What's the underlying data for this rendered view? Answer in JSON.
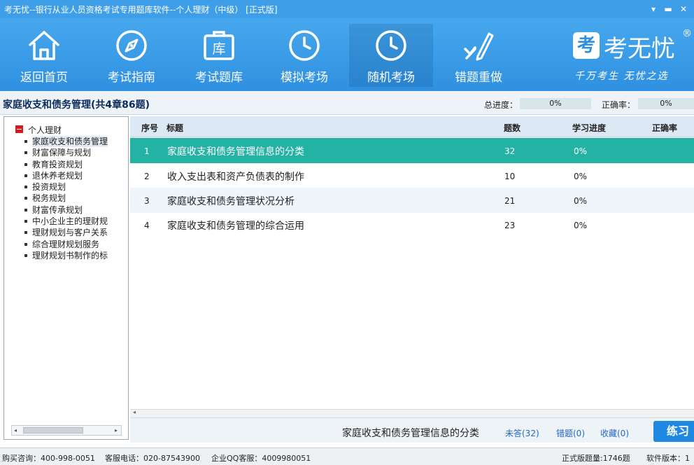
{
  "window": {
    "title": "考无忧--银行从业人员资格考试专用题库软件--个人理财（中级）  [正式版]",
    "menu_glyph": "▾",
    "min_glyph": "▬",
    "close_glyph": "✕"
  },
  "toolbar": {
    "items": [
      {
        "label": "返回首页",
        "icon": "home-icon"
      },
      {
        "label": "考试指南",
        "icon": "compass-icon"
      },
      {
        "label": "考试题库",
        "icon": "question-bank-icon",
        "icon_text": "库"
      },
      {
        "label": "模拟考场",
        "icon": "clock-icon"
      },
      {
        "label": "随机考场",
        "icon": "clock-icon"
      },
      {
        "label": "错题重做",
        "icon": "pen-check-icon"
      }
    ],
    "active_index": 4
  },
  "logo": {
    "mark": "考",
    "brand": "考无忧",
    "reg": "®",
    "slogan": "千万考生  无忧之选"
  },
  "header": {
    "title": "家庭收支和债务管理(共4章86题)",
    "progress_label": "总进度：",
    "progress_value": "0%",
    "accuracy_label": "正确率：",
    "accuracy_value": "0%"
  },
  "tree": {
    "root": "个人理财",
    "items": [
      "家庭收支和债务管理",
      "财富保障与规划",
      "教育投资规划",
      "退休养老规划",
      "投资规划",
      "税务规划",
      "财富传承规划",
      "中小企业主的理财规",
      "理财规划与客户关系",
      "综合理财规划服务",
      "理财规划书制作的标"
    ],
    "selected_index": 0,
    "scroll_left": "◂",
    "scroll_right": "▸"
  },
  "table": {
    "columns": {
      "index": "序号",
      "title": "标题",
      "count": "题数",
      "progress": "学习进度",
      "accuracy": "正确率"
    },
    "rows": [
      {
        "index": "1",
        "title": "家庭收支和债务管理信息的分类",
        "count": "32",
        "progress": "0%"
      },
      {
        "index": "2",
        "title": "收入支出表和资产负债表的制作",
        "count": "10",
        "progress": "0%"
      },
      {
        "index": "3",
        "title": "家庭收支和债务管理状况分析",
        "count": "21",
        "progress": "0%"
      },
      {
        "index": "4",
        "title": "家庭收支和债务管理的综合运用",
        "count": "23",
        "progress": "0%"
      }
    ],
    "selected_index": 0,
    "scroll_left": "◂"
  },
  "actions": {
    "current": "家庭收支和债务管理信息的分类",
    "unanswered": "未答(32)",
    "wrong": "错题(0)",
    "favorites": "收藏(0)",
    "practice": "练习"
  },
  "status": {
    "purchase": "购买咨询：400-998-0051",
    "service": "客服电话：020-87543900",
    "qq": "企业QQ客服：4009980051",
    "question_total": "正式版题量:1746题",
    "version": "软件版本：1"
  },
  "colors": {
    "toolbar_blue": "#3f9ee8",
    "selected_row": "#24b2a4",
    "link_blue": "#2168c4",
    "practice_button": "#1f88e0"
  }
}
